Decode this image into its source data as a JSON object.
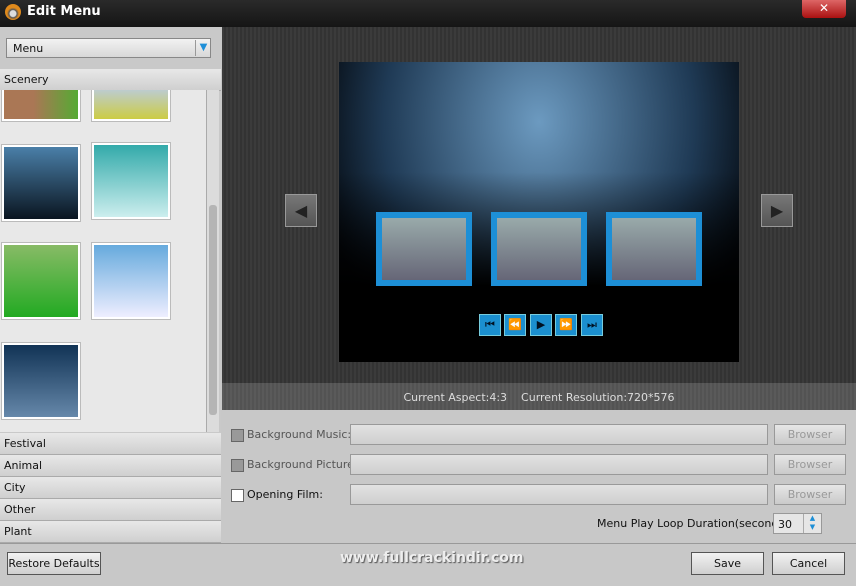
{
  "window": {
    "title": "Edit Menu",
    "close_label": "✕"
  },
  "sidebar": {
    "dropdown_value": "Menu",
    "active_category": "Scenery",
    "categories": [
      "Festival",
      "Animal",
      "City",
      "Other",
      "Plant"
    ]
  },
  "preview": {
    "aspect_label": "Current Aspect:4:3",
    "resolution_label": "Current Resolution:720*576",
    "controls": [
      "⏮",
      "⏪",
      "▶",
      "⏩",
      "⏭"
    ],
    "prev": "◀",
    "next": "▶"
  },
  "form": {
    "background_music_label": "Background Music:",
    "background_picture_label": "Background Picture:",
    "opening_film_label": "Opening Film:",
    "browser_label": "Browser",
    "loop_label": "Menu Play Loop Duration(seconds):",
    "loop_value": "30"
  },
  "footer": {
    "restore_label": "Restore Defaults",
    "save_label": "Save",
    "cancel_label": "Cancel",
    "watermark": "www.fullcrackindir.com"
  },
  "colors": {
    "accent": "#1d8fd6"
  }
}
